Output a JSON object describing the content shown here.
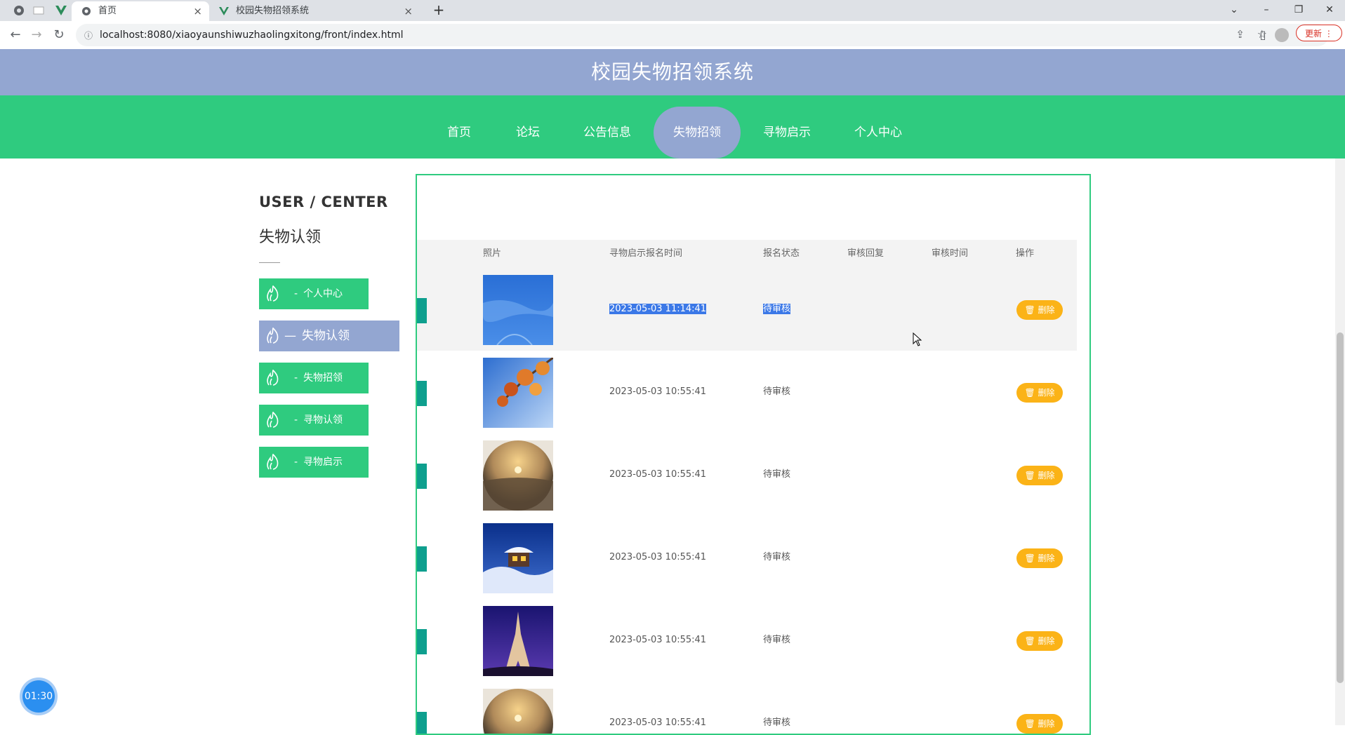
{
  "browser": {
    "tabs": [
      {
        "title": "首页",
        "active": true
      },
      {
        "title": "校园失物招领系统",
        "active": false
      }
    ],
    "url": "localhost:8080/xiaoyaunshiwuzhaolingxitong/front/index.html",
    "update_label": "更新"
  },
  "site": {
    "title": "校园失物招领系统",
    "nav": [
      {
        "label": "首页",
        "active": false
      },
      {
        "label": "论坛",
        "active": false
      },
      {
        "label": "公告信息",
        "active": false
      },
      {
        "label": "失物招领",
        "active": true
      },
      {
        "label": "寻物启示",
        "active": false
      },
      {
        "label": "个人中心",
        "active": false
      }
    ]
  },
  "sidebar": {
    "title": "USER / CENTER",
    "subtitle": "失物认领",
    "items": [
      {
        "label": "个人中心",
        "prefix": "-",
        "active": false
      },
      {
        "label": "失物认领",
        "prefix": "—",
        "active": true
      },
      {
        "label": "失物招领",
        "prefix": "-",
        "active": false
      },
      {
        "label": "寻物认领",
        "prefix": "-",
        "active": false
      },
      {
        "label": "寻物启示",
        "prefix": "-",
        "active": false
      }
    ]
  },
  "table": {
    "headers": [
      "照片",
      "寻物启示报名时间",
      "报名状态",
      "审核回复",
      "审核时间",
      "操作"
    ],
    "delete_label": "删除",
    "rows": [
      {
        "photo": "snow-blue-photo",
        "time": "2023-05-03 11:14:41",
        "status": "待审核",
        "selected": true
      },
      {
        "photo": "autumn-leaves-photo",
        "time": "2023-05-03 10:55:41",
        "status": "待审核",
        "selected": false
      },
      {
        "photo": "fisheye-sunset-photo",
        "time": "2023-05-03 10:55:41",
        "status": "待审核",
        "selected": false
      },
      {
        "photo": "snow-cabin-photo",
        "time": "2023-05-03 10:55:41",
        "status": "待审核",
        "selected": false
      },
      {
        "photo": "eiffel-tower-photo",
        "time": "2023-05-03 10:55:41",
        "status": "待审核",
        "selected": false
      },
      {
        "photo": "fisheye-sunset-photo",
        "time": "2023-05-03 10:55:41",
        "status": "待审核",
        "selected": false
      }
    ]
  },
  "timer": {
    "value": "01:30"
  },
  "colors": {
    "header": "#93a6d1",
    "nav": "#2fcb7f",
    "delete": "#fbb317",
    "accent_mark": "#0e9f8e"
  }
}
